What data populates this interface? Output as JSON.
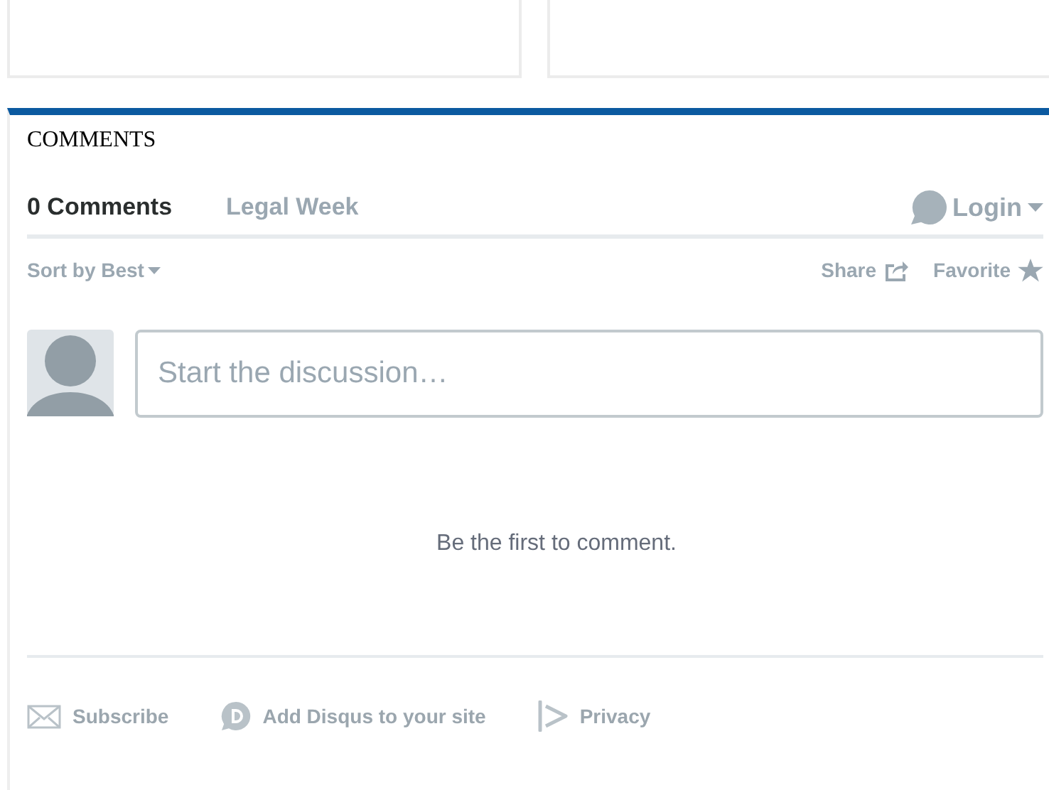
{
  "section_title": "COMMENTS",
  "tabs": [
    {
      "label": "0 Comments",
      "selected": true
    },
    {
      "label": "Legal Week",
      "selected": false
    }
  ],
  "login": "Login",
  "sort": "Sort by Best",
  "actions": [
    {
      "kind": "share",
      "label": "Share"
    },
    {
      "kind": "favorite",
      "label": "Favorite"
    }
  ],
  "composer": {
    "placeholder": "Start the discussion…"
  },
  "empty_message": "Be the first to comment.",
  "footer": [
    {
      "kind": "subscribe",
      "label": "Subscribe"
    },
    {
      "kind": "disqus",
      "label": "Add Disqus to your site"
    },
    {
      "kind": "privacy",
      "label": "Privacy"
    }
  ]
}
